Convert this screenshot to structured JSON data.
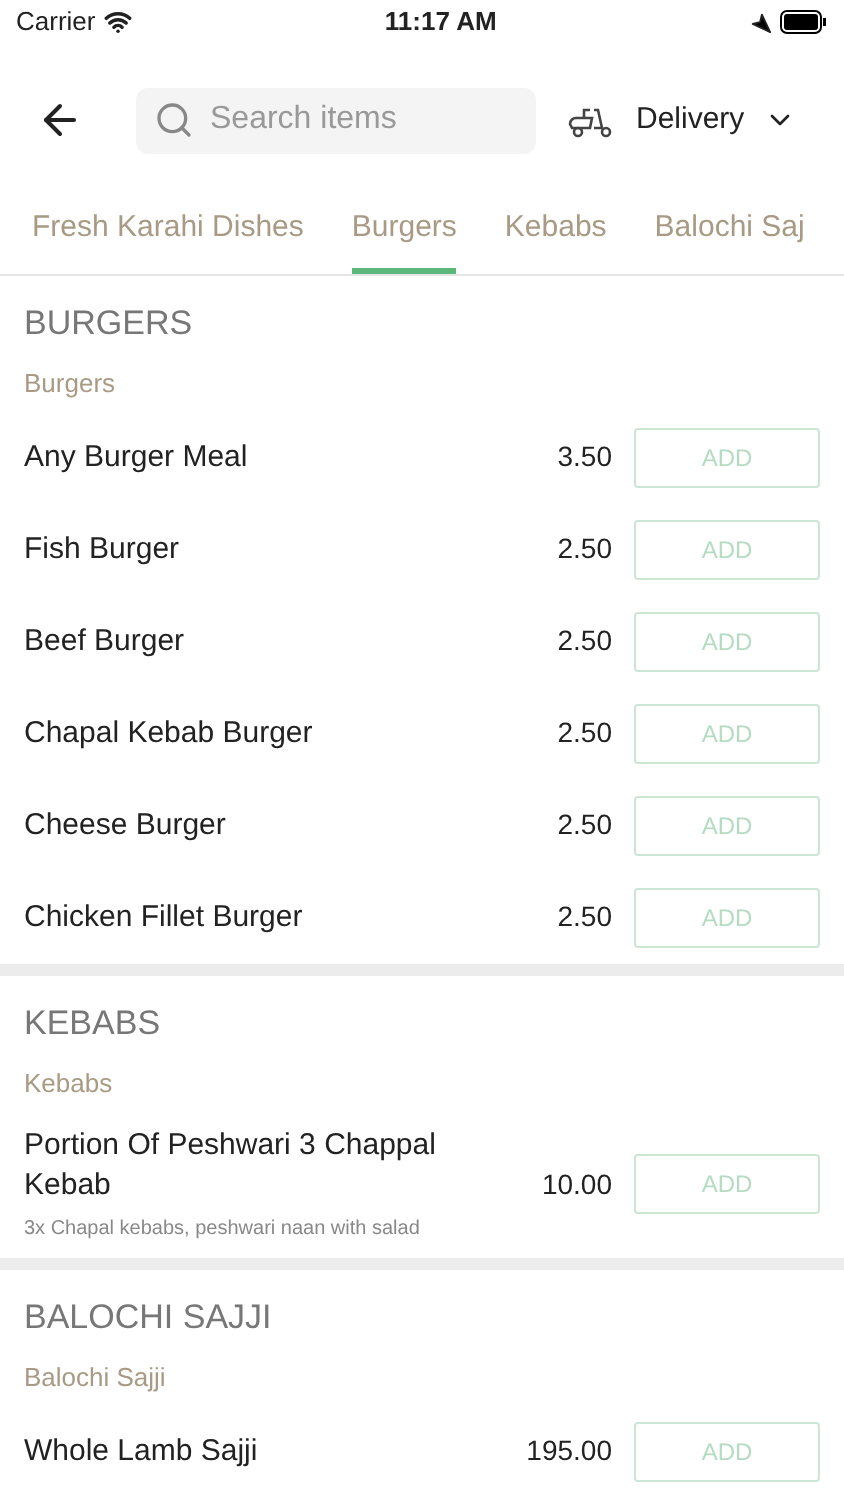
{
  "status_bar": {
    "carrier": "Carrier",
    "time": "11:17 AM"
  },
  "header": {
    "search": {
      "placeholder": "Search items"
    },
    "order_type": "Delivery"
  },
  "tabs": [
    {
      "label": "Fresh Karahi Dishes",
      "selected": false
    },
    {
      "label": "Burgers",
      "selected": true
    },
    {
      "label": "Kebabs",
      "selected": false
    },
    {
      "label": "Balochi Saj",
      "selected": false
    }
  ],
  "sections": [
    {
      "title": "BURGERS",
      "subtitle": "Burgers",
      "items": [
        {
          "name": "Any Burger Meal",
          "price": "3.50",
          "button": "ADD"
        },
        {
          "name": "Fish Burger",
          "price": "2.50",
          "button": "ADD"
        },
        {
          "name": "Beef Burger",
          "price": "2.50",
          "button": "ADD"
        },
        {
          "name": "Chapal Kebab Burger",
          "price": "2.50",
          "button": "ADD"
        },
        {
          "name": "Cheese Burger",
          "price": "2.50",
          "button": "ADD"
        },
        {
          "name": "Chicken Fillet Burger",
          "price": "2.50",
          "button": "ADD"
        }
      ]
    },
    {
      "title": "KEBABS",
      "subtitle": "Kebabs",
      "items": [
        {
          "name": "Portion Of Peshwari 3 Chappal Kebab",
          "price": "10.00",
          "button": "ADD",
          "description": "3x  Chapal kebabs, peshwari naan with salad"
        }
      ]
    },
    {
      "title": "BALOCHI SAJJI",
      "subtitle": "Balochi Sajji",
      "items": [
        {
          "name": "Whole Lamb Sajji",
          "price": "195.00",
          "button": "ADD"
        }
      ]
    }
  ]
}
